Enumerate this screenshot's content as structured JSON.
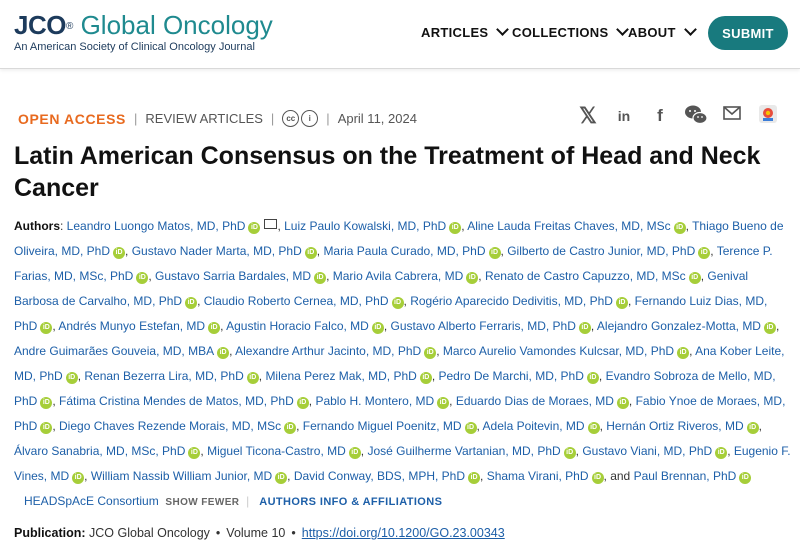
{
  "header": {
    "logo_jco": "JCO",
    "logo_reg": "®",
    "logo_global": "Global Oncology",
    "logo_sub": "An American Society of Clinical Oncology Journal",
    "nav": [
      "ARTICLES",
      "COLLECTIONS",
      "ABOUT"
    ],
    "submit": "SUBMIT"
  },
  "meta": {
    "open_access": "OPEN ACCESS",
    "type": "REVIEW ARTICLES",
    "date": "April 11, 2024"
  },
  "share_icons": [
    "x-icon",
    "linkedin-icon",
    "facebook-icon",
    "wechat-icon",
    "email-icon",
    "mendeley-icon"
  ],
  "title": "Latin American Consensus on the Treatment of Head and Neck Cancer",
  "authors_label": "Authors",
  "authors": [
    "Leandro Luongo Matos, MD, PhD",
    "Luiz Paulo Kowalski, MD, PhD",
    "Aline Lauda Freitas Chaves, MD, MSc",
    "Thiago Bueno de Oliveira, MD, PhD",
    "Gustavo Nader Marta, MD, PhD",
    "Maria Paula Curado, MD, PhD",
    "Gilberto de Castro Junior, MD, PhD",
    "Terence P. Farias, MD, MSc, PhD",
    "Gustavo Sarria Bardales, MD",
    "Mario Avila Cabrera, MD",
    "Renato de Castro Capuzzo, MD, MSc",
    "Genival Barbosa de Carvalho, MD, PhD",
    "Claudio Roberto Cernea, MD, PhD",
    "Rogério Aparecido Dedivitis, MD, PhD",
    "Fernando Luiz Dias, MD, PhD",
    "Andrés Munyo Estefan, MD",
    "Agustin Horacio Falco, MD",
    "Gustavo Alberto Ferraris, MD, PhD",
    "Alejandro Gonzalez-Motta, MD",
    "Andre Guimarães Gouveia, MD, MBA",
    "Alexandre Arthur Jacinto, MD, PhD",
    "Marco Aurelio Vamondes Kulcsar, MD, PhD",
    "Ana Kober Leite, MD, PhD",
    "Renan Bezerra Lira, MD, PhD",
    "Milena Perez Mak, MD, PhD",
    "Pedro De Marchi, MD, PhD",
    "Evandro Sobroza de Mello, MD, PhD",
    "Fátima Cristina Mendes de Matos, MD, PhD",
    "Pablo H. Montero, MD",
    "Eduardo Dias de Moraes, MD",
    "Fabio Ynoe de Moraes, MD, PhD",
    "Diego Chaves Rezende Morais, MD, MSc",
    "Fernando Miguel Poenitz, MD",
    "Adela Poitevin, MD",
    "Hernán Ortiz Riveros, MD",
    "Álvaro Sanabria, MD, MSc, PhD",
    "Miguel Ticona-Castro, MD",
    "José Guilherme Vartanian, MD, PhD",
    "Gustavo Viani, MD, PhD",
    "Eugenio F. Vines, MD",
    "William Nassib William Junior, MD",
    "David Conway, BDS, MPH, PhD",
    "Shama Virani, PhD",
    "Paul Brennan, PhD",
    "HEADSpAcE Consortium"
  ],
  "and_text": ", and ",
  "show_fewer": "SHOW FEWER",
  "affiliations": "AUTHORS INFO & AFFILIATIONS",
  "publication": {
    "label": "Publication:",
    "journal": "JCO Global Oncology",
    "volume": "Volume 10",
    "doi": "https://doi.org/10.1200/GO.23.00343"
  },
  "colors": {
    "accent_teal": "#187a7e",
    "open_access": "#e86a1f",
    "link": "#1d5fa8",
    "orcid": "#a6ce39"
  }
}
